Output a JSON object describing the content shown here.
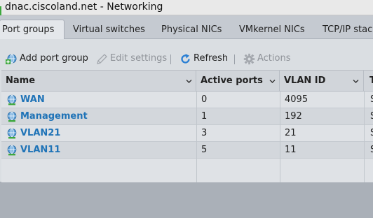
{
  "window": {
    "title": "dnac.ciscoland.net - Networking"
  },
  "tabs": [
    {
      "label": "Port groups",
      "active": true
    },
    {
      "label": "Virtual switches",
      "active": false
    },
    {
      "label": "Physical NICs",
      "active": false
    },
    {
      "label": "VMkernel NICs",
      "active": false
    },
    {
      "label": "TCP/IP stack",
      "active": false
    }
  ],
  "toolbar": {
    "add_port_group": "Add port group",
    "edit_settings": "Edit settings",
    "refresh": "Refresh",
    "actions": "Actions"
  },
  "table": {
    "columns": [
      "Name",
      "Active ports",
      "VLAN ID",
      "T"
    ],
    "rows": [
      {
        "name": "WAN",
        "active_ports": "0",
        "vlan_id": "4095",
        "type": "S"
      },
      {
        "name": "Management",
        "active_ports": "1",
        "vlan_id": "192",
        "type": "S"
      },
      {
        "name": "VLAN21",
        "active_ports": "3",
        "vlan_id": "21",
        "type": "S"
      },
      {
        "name": "VLAN11",
        "active_ports": "5",
        "vlan_id": "11",
        "type": "S"
      }
    ]
  },
  "colors": {
    "link": "#1f73b7",
    "accent_green": "#3ea83e",
    "refresh_blue": "#2a7fd4"
  },
  "icons": {
    "add": "add-port-group-icon",
    "edit": "pencil-icon",
    "refresh": "refresh-icon",
    "actions": "gear-icon",
    "row": "port-group-globe-icon",
    "sort": "chevron-down-icon"
  }
}
